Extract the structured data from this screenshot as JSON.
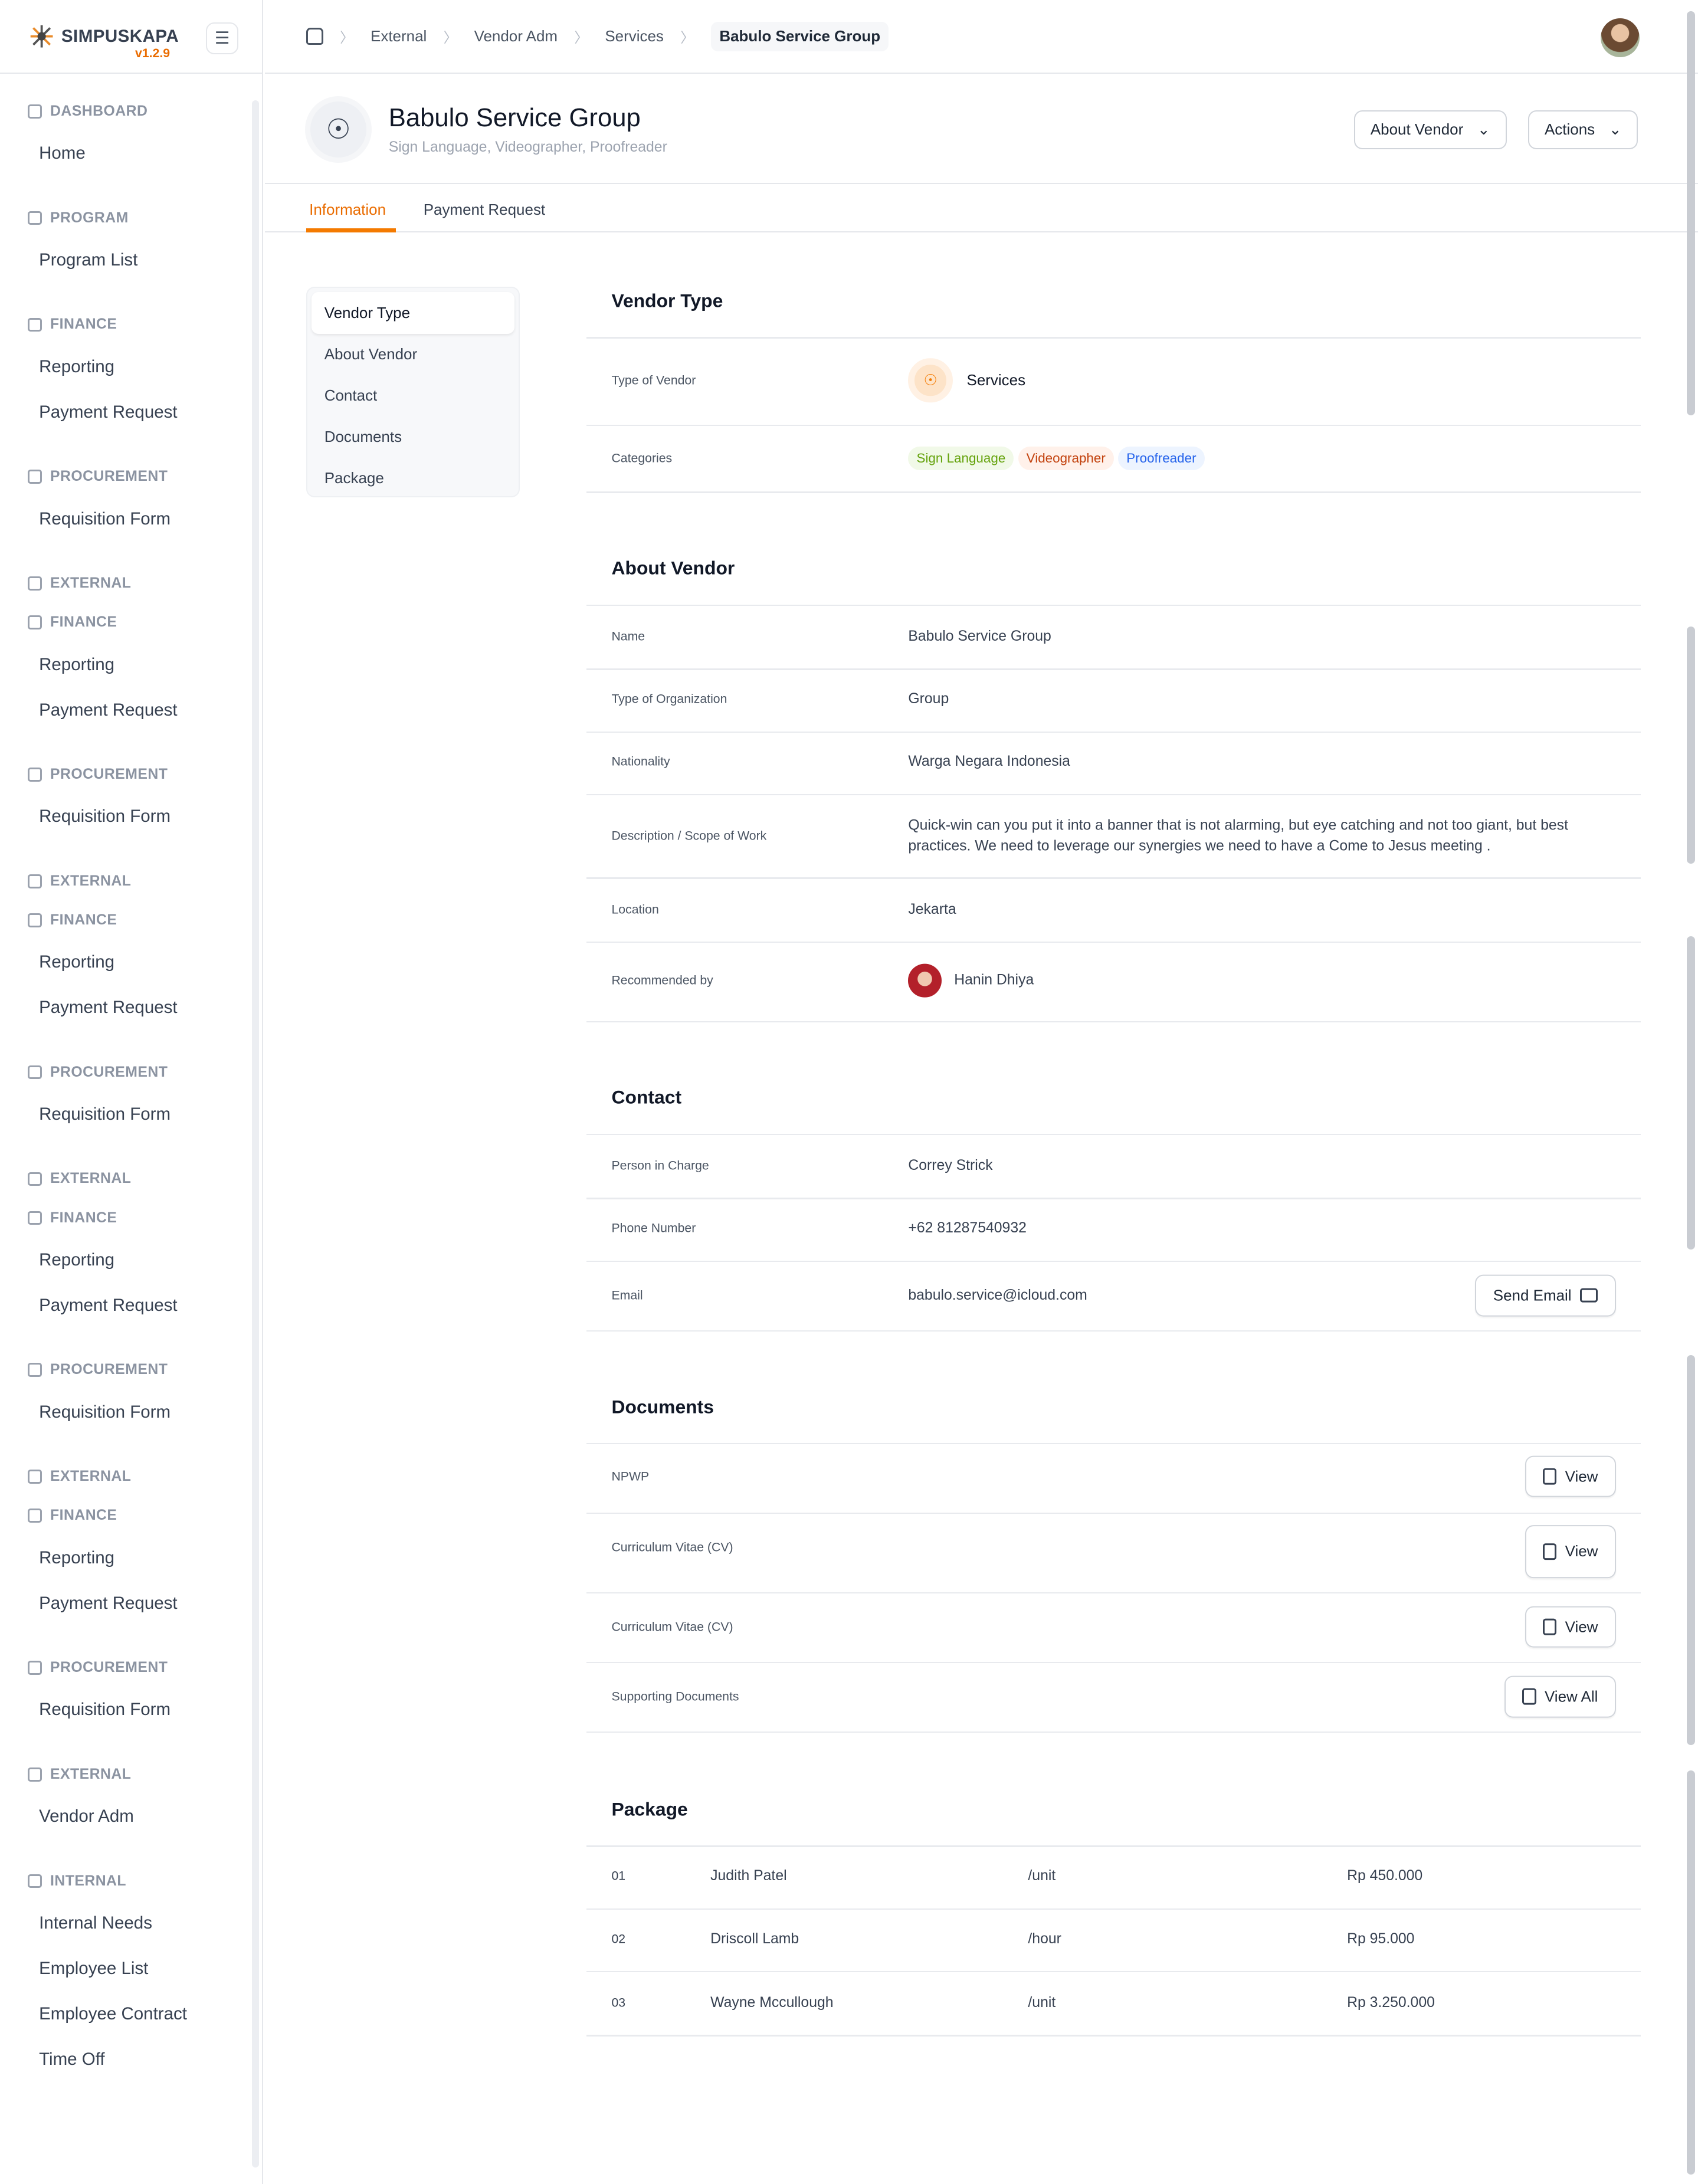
{
  "app": {
    "name": "SIMPUSKAPA",
    "version": "v1.2.9"
  },
  "sidebar": {
    "groups": [
      {
        "heading": "DASHBOARD",
        "items": [
          "Home"
        ]
      },
      {
        "heading": "PROGRAM",
        "items": [
          "Program List"
        ]
      },
      {
        "heading": "FINANCE",
        "items": [
          "Reporting",
          "Payment Request"
        ]
      },
      {
        "heading": "PROCUREMENT",
        "items": [
          "Requisition Form"
        ]
      },
      {
        "heading": "EXTERNAL",
        "items": [],
        "tight": true
      },
      {
        "heading": "FINANCE",
        "items": [
          "Reporting",
          "Payment Request"
        ]
      },
      {
        "heading": "PROCUREMENT",
        "items": [
          "Requisition Form"
        ]
      },
      {
        "heading": "EXTERNAL",
        "items": [],
        "tight": true
      },
      {
        "heading": "FINANCE",
        "items": [
          "Reporting",
          "Payment Request"
        ]
      },
      {
        "heading": "PROCUREMENT",
        "items": [
          "Requisition Form"
        ]
      },
      {
        "heading": "EXTERNAL",
        "items": [],
        "tight": true
      },
      {
        "heading": "FINANCE",
        "items": [
          "Reporting",
          "Payment Request"
        ]
      },
      {
        "heading": "PROCUREMENT",
        "items": [
          "Requisition Form"
        ]
      },
      {
        "heading": "EXTERNAL",
        "items": [],
        "tight": true
      },
      {
        "heading": "FINANCE",
        "items": [
          "Reporting",
          "Payment Request"
        ]
      },
      {
        "heading": "PROCUREMENT",
        "items": [
          "Requisition Form"
        ]
      },
      {
        "heading": "EXTERNAL",
        "items": [
          "Vendor Adm"
        ]
      },
      {
        "heading": "INTERNAL",
        "items": [
          "Internal Needs",
          "Employee List",
          "Employee Contract",
          "Time Off"
        ]
      }
    ]
  },
  "breadcrumb": [
    "External",
    "Vendor Adm",
    "Services",
    "Babulo Service Group"
  ],
  "header": {
    "title": "Babulo Service Group",
    "subtitle": "Sign Language, Videographer, Proofreader",
    "about_btn": "About Vendor",
    "actions_btn": "Actions"
  },
  "tabs": [
    "Information",
    "Payment Request"
  ],
  "section_nav": [
    "Vendor Type",
    "About Vendor",
    "Contact",
    "Documents",
    "Package"
  ],
  "vendor_type": {
    "title": "Vendor Type",
    "type_label": "Type of Vendor",
    "type_value": "Services",
    "categories_label": "Categories",
    "categories": [
      {
        "label": "Sign Language",
        "color": "#65a30d",
        "bg": "#f1f9e8"
      },
      {
        "label": "Videographer",
        "color": "#c2410c",
        "bg": "#fff1ea"
      },
      {
        "label": "Proofreader",
        "color": "#2563eb",
        "bg": "#edf4ff"
      }
    ]
  },
  "about": {
    "title": "About Vendor",
    "rows": [
      {
        "label": "Name",
        "value": "Babulo Service Group"
      },
      {
        "label": "Type of Organization",
        "value": "Group"
      },
      {
        "label": "Nationality",
        "value": "Warga Negara Indonesia"
      },
      {
        "label": "Description / Scope of Work",
        "value": "Quick-win can you put it into a banner that is not alarming, but eye catching and not too giant, but best practices. We need to leverage our synergies we need to have a Come to Jesus meeting ."
      },
      {
        "label": "Location",
        "value": "Jekarta"
      },
      {
        "label": "Recommended by",
        "value": "Hanin Dhiya"
      }
    ]
  },
  "contact": {
    "title": "Contact",
    "rows": [
      {
        "label": "Person in Charge",
        "value": "Correy Strick"
      },
      {
        "label": "Phone Number",
        "value": "+62 81287540932"
      },
      {
        "label": "Email",
        "value": "babulo.service@icloud.com"
      }
    ],
    "send_email": "Send Email"
  },
  "documents": {
    "title": "Documents",
    "rows": [
      {
        "label": "NPWP",
        "button": "View"
      },
      {
        "label": "Curriculum Vitae (CV)",
        "button": "View"
      },
      {
        "label": "Curriculum Vitae (CV)",
        "button": "View"
      },
      {
        "label": "Supporting Documents",
        "button": "View All"
      }
    ]
  },
  "package": {
    "title": "Package",
    "rows": [
      {
        "no": "01",
        "name": "Judith Patel",
        "unit": "/unit",
        "price": "Rp 450.000"
      },
      {
        "no": "02",
        "name": "Driscoll Lamb",
        "unit": "/hour",
        "price": "Rp 95.000"
      },
      {
        "no": "03",
        "name": "Wayne Mccullough",
        "unit": "/unit",
        "price": "Rp 3.250.000"
      }
    ]
  },
  "colors": {
    "accent": "#f47a00"
  }
}
